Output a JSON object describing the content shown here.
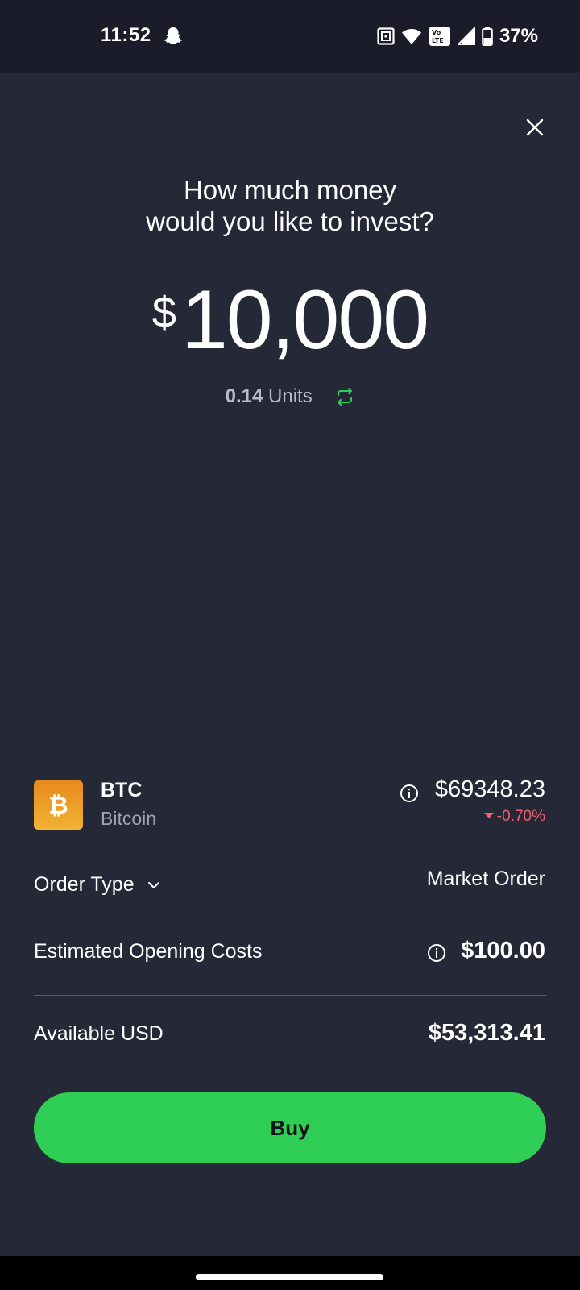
{
  "status_bar": {
    "time": "11:52",
    "battery_percent": "37%",
    "icons": [
      "snapchat-icon",
      "nfc-icon",
      "wifi-icon",
      "volte-icon",
      "signal-icon",
      "battery-icon"
    ]
  },
  "header": {
    "close_icon": "close-icon",
    "question_line1": "How much money",
    "question_line2": "would you like to invest?"
  },
  "amount": {
    "currency": "$",
    "value": "10,000",
    "units_value": "0.14",
    "units_label": "Units",
    "swap_icon": "swap-icon"
  },
  "asset": {
    "symbol": "BTC",
    "name": "Bitcoin",
    "price": "$69348.23",
    "change": "-0.70%",
    "logo_icon": "bitcoin-icon",
    "logo_color": "#e8891c"
  },
  "order": {
    "label": "Order Type",
    "value": "Market Order"
  },
  "costs": {
    "label": "Estimated Opening Costs",
    "value": "$100.00"
  },
  "available": {
    "label": "Available USD",
    "value": "$53,313.41"
  },
  "buy_button": {
    "label": "Buy",
    "color": "#2ecf54"
  },
  "colors": {
    "background": "#252836",
    "status_bar": "#1a1d29",
    "accent_green": "#2ecf54",
    "negative_red": "#f0616d"
  }
}
